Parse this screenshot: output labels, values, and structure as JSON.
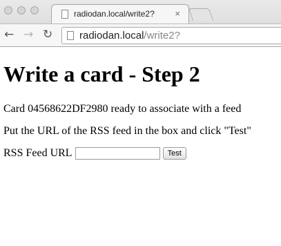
{
  "browser": {
    "tab_title": "radiodan.local/write2?",
    "tab_close": "×",
    "url_host": "radiodan.local",
    "url_path": "/write2?",
    "back_glyph": "←",
    "forward_glyph": "→",
    "reload_glyph": "↻",
    "traffic_light_color": "#d5d5d5"
  },
  "page": {
    "heading": "Write a card - Step 2",
    "card_message": "Card 04568622DF2980 ready to associate with a feed",
    "instruction": "Put the URL of the RSS feed in the box and click \"Test\"",
    "form": {
      "label": "RSS Feed URL",
      "input_value": "",
      "button_label": "Test"
    }
  }
}
